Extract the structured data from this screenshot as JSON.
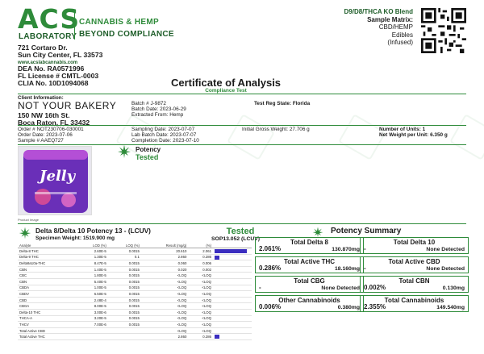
{
  "lab": {
    "logo": "ACS",
    "logo_sub": "LABORATORY",
    "tag1": "CANNABIS & HEMP",
    "tag2": "BEYOND COMPLIANCE",
    "addr1": "721 Cortaro Dr.",
    "addr2": "Sun City Center, FL 33573",
    "website": "www.acslabcannabis.com",
    "dea": "DEA No. RA0571996",
    "fl_license": "FL License # CMTL-0003",
    "clia": "CLIA No. 10D1094068"
  },
  "matrix": {
    "product": "D9/D8/THCA KO Blend",
    "label": "Sample Matrix:",
    "l1": "CBD/HEMP",
    "l2": "Edibles",
    "l3": "(Infused)"
  },
  "title": "Certificate of Analysis",
  "subtitle": "Compliance Test",
  "client": {
    "label": "Client Information:",
    "name": "NOT YOUR BAKERY",
    "addr1": "150 NW 16th St.",
    "addr2": "Boca Raton, FL 33432"
  },
  "batch": {
    "batch_no": "Batch # J-9872",
    "batch_date": "Batch Date: 2023-06-29",
    "extracted": "Extracted From: Hemp",
    "test_reg": "Test Reg State: Florida"
  },
  "order": {
    "order_no": "Order # NOT230706-030001",
    "order_date": "Order Date: 2023-07-06",
    "sample": "Sample # AAEQ727",
    "sampling_date": "Sampling Date: 2023-07-07",
    "lab_batch_date": "Lab Batch Date: 2023-07-07",
    "completion_date": "Completion Date: 2023-07-10",
    "gross_weight": "Initial Gross Weight: 27.706 g",
    "units": "Number of Units: 1",
    "net_weight": "Net Weight per Unit: 6.350 g"
  },
  "status": {
    "potency": "Potency",
    "tested": "Tested"
  },
  "product_image": {
    "brand": "Jelly",
    "caption": "Product Image"
  },
  "potency_table": {
    "title": "Delta 8/Delta 10 Potency 13 - (LCUV)",
    "specimen": "Specimen Weight: 1519.900 mg",
    "tested": "Tested",
    "sop": "SOP13.052 (LCUV)",
    "headers": [
      "Analyte",
      "LOD (%)",
      "LOQ (%)",
      "Result (mg/g)",
      "(%)"
    ],
    "rows": [
      {
        "name": "Delta-8 THC",
        "lod": "2.60E-5",
        "loq": "0.0015",
        "mg": "20.610",
        "pct": "2.061",
        "bar": 2.061
      },
      {
        "name": "Delta-9 THC",
        "lod": "1.30E-5",
        "loq": "0.1",
        "mg": "2.860",
        "pct": "0.286",
        "bar": 0.286
      },
      {
        "name": "Delta9a10a-THC",
        "lod": "8.47E-5",
        "loq": "0.0015",
        "mg": "0.060",
        "pct": "0.006",
        "bar": 0
      },
      {
        "name": "CBN",
        "lod": "1.40E-5",
        "loq": "0.0015",
        "mg": "0.020",
        "pct": "0.002",
        "bar": 0
      },
      {
        "name": "CBC",
        "lod": "1.80E-5",
        "loq": "0.0015",
        "mg": "<LOQ",
        "pct": "<LOQ",
        "bar": 0
      },
      {
        "name": "CBN",
        "lod": "5.40E-5",
        "loq": "0.0015",
        "mg": "<LOQ",
        "pct": "<LOQ",
        "bar": 0
      },
      {
        "name": "CBDA",
        "lod": "1.00E-5",
        "loq": "0.0015",
        "mg": "<LOQ",
        "pct": "<LOQ",
        "bar": 0
      },
      {
        "name": "CBDV",
        "lod": "6.50E-5",
        "loq": "0.0015",
        "mg": "<LOQ",
        "pct": "<LOQ",
        "bar": 0
      },
      {
        "name": "CBD",
        "lod": "2.48E-4",
        "loq": "0.0015",
        "mg": "<LOQ",
        "pct": "<LOQ",
        "bar": 0
      },
      {
        "name": "CBGA",
        "lod": "8.00E-5",
        "loq": "0.0015",
        "mg": "<LOQ",
        "pct": "<LOQ",
        "bar": 0
      },
      {
        "name": "Delta-10 THC",
        "lod": "3.00E-6",
        "loq": "0.0015",
        "mg": "<LOQ",
        "pct": "<LOQ",
        "bar": 0
      },
      {
        "name": "THCA-A",
        "lod": "3.20E-5",
        "loq": "0.0015",
        "mg": "<LOQ",
        "pct": "<LOQ",
        "bar": 0
      },
      {
        "name": "THCV",
        "lod": "7.00E-6",
        "loq": "0.0015",
        "mg": "<LOQ",
        "pct": "<LOQ",
        "bar": 0
      },
      {
        "name": "Total Active CBD",
        "lod": "",
        "loq": "",
        "mg": "<LOQ",
        "pct": "<LOQ",
        "bar": 0
      },
      {
        "name": "Total Active THC",
        "lod": "",
        "loq": "",
        "mg": "2.860",
        "pct": "0.286",
        "bar": 0.286
      }
    ]
  },
  "summary": {
    "title": "Potency Summary",
    "boxes": [
      {
        "title": "Total Delta 8",
        "pct": "2.061%",
        "mg": "130.870mg"
      },
      {
        "title": "Total Delta 10",
        "pct": "-",
        "mg": "None Detected"
      },
      {
        "title": "Total Active THC",
        "pct": "0.286%",
        "mg": "18.160mg"
      },
      {
        "title": "Total Active CBD",
        "pct": "-",
        "mg": "None Detected"
      },
      {
        "title": "Total CBG",
        "pct": "-",
        "mg": "None Detected"
      },
      {
        "title": "Total CBN",
        "pct": "0.002%",
        "mg": "0.130mg"
      },
      {
        "title": "Other Cannabinoids",
        "pct": "0.006%",
        "mg": "0.380mg"
      },
      {
        "title": "Total Cannabinoids",
        "pct": "2.355%",
        "mg": "149.540mg"
      }
    ]
  },
  "colors": {
    "brand_green": "#2e8b3a",
    "bar": "#3b2ec0"
  }
}
